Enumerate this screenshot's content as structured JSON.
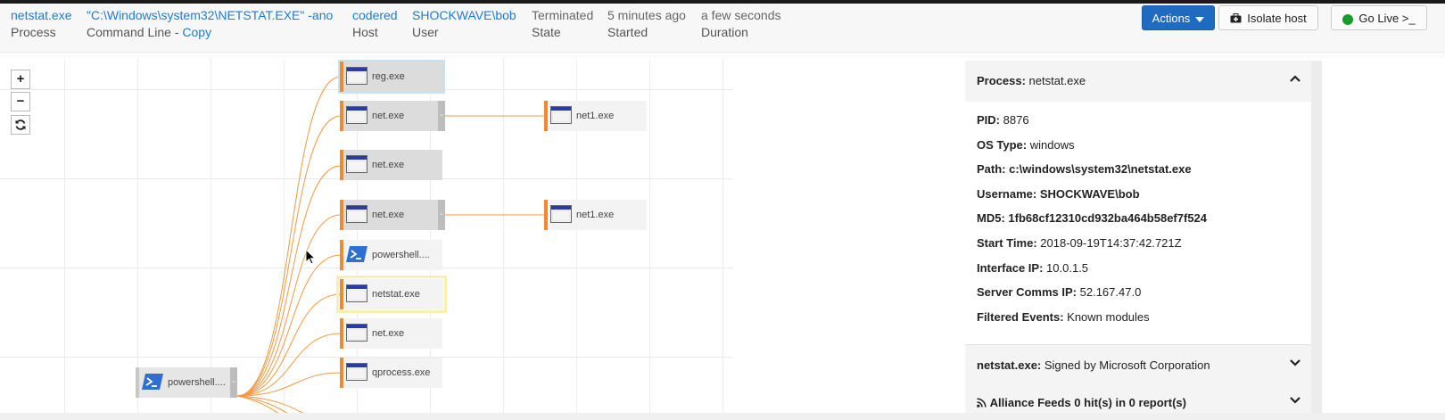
{
  "header": {
    "process": {
      "value": "netstat.exe",
      "label": "Process"
    },
    "command": {
      "value": "\"C:\\Windows\\system32\\NETSTAT.EXE\" -ano",
      "label": "Command Line - ",
      "copy": "Copy"
    },
    "host": {
      "value": "codered",
      "label": "Host"
    },
    "user": {
      "value": "SHOCKWAVE\\bob",
      "label": "User"
    },
    "state": {
      "value": "Terminated",
      "label": "State"
    },
    "started": {
      "value": "5 minutes ago",
      "label": "Started"
    },
    "duration": {
      "value": "a few seconds",
      "label": "Duration"
    },
    "actions_label": "Actions",
    "isolate_label": "Isolate host",
    "golive_label": "Go Live >_"
  },
  "zoom": {
    "in": "+",
    "out": "−",
    "reset_icon": "refresh-icon"
  },
  "tree": {
    "root": {
      "label": "powershell....",
      "icon": "powershell-icon"
    },
    "children": [
      {
        "label": "reg.exe",
        "icon": "window-icon"
      },
      {
        "label": "net.exe",
        "icon": "window-icon",
        "expand": "-"
      },
      {
        "label": "net.exe",
        "icon": "window-icon"
      },
      {
        "label": "net.exe",
        "icon": "window-icon",
        "expand": "-"
      },
      {
        "label": "powershell....",
        "icon": "powershell-icon"
      },
      {
        "label": "netstat.exe",
        "icon": "window-icon"
      },
      {
        "label": "net.exe",
        "icon": "window-icon"
      },
      {
        "label": "qprocess.exe",
        "icon": "window-icon"
      }
    ],
    "grandchildren": [
      {
        "label": "net1.exe",
        "icon": "window-icon"
      },
      {
        "label": "net1.exe",
        "icon": "window-icon"
      }
    ],
    "root_expand": "-"
  },
  "panel": {
    "title_key": "Process:",
    "title_val": "netstat.exe",
    "fields": [
      {
        "k": "PID:",
        "v": "8876"
      },
      {
        "k": "OS Type:",
        "v": "windows"
      },
      {
        "k": "Path:",
        "v": "c:\\windows\\system32\\netstat.exe"
      },
      {
        "k": "Username:",
        "v": "SHOCKWAVE\\bob"
      },
      {
        "k": "MD5:",
        "v": "1fb68cf12310cd932ba464b58ef7f524"
      },
      {
        "k": "Start Time:",
        "v": "2018-09-19T14:37:42.721Z"
      },
      {
        "k": "Interface IP:",
        "v": "10.0.1.5"
      },
      {
        "k": "Server Comms IP:",
        "v": "52.167.47.0"
      },
      {
        "k": "Filtered Events:",
        "v": "Known modules"
      }
    ],
    "signed_key": "netstat.exe:",
    "signed_val": "Signed by Microsoft Corporation",
    "feeds_label": "Alliance Feeds 0 hit(s) in 0 report(s)"
  },
  "colors": {
    "link": "#1f7bd6",
    "accent": "#f08a30",
    "primary": "#1e6bc1",
    "live": "#1a9a2a"
  }
}
